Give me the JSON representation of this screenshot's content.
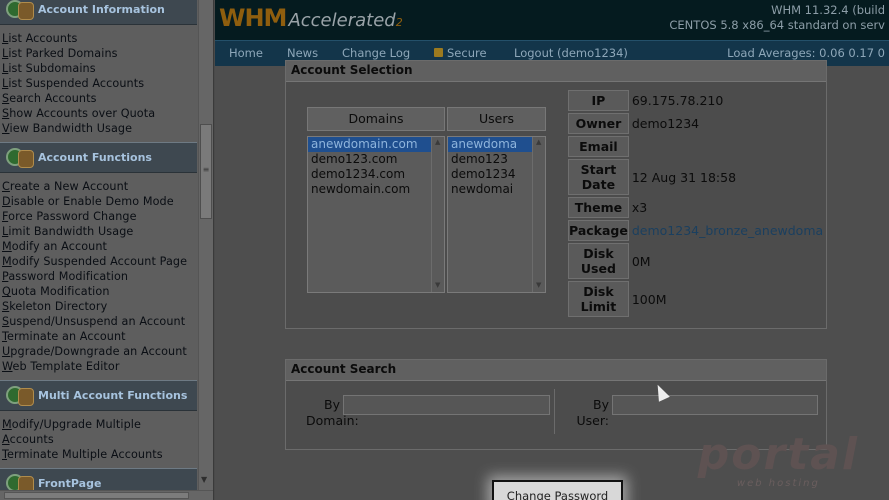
{
  "sidebar": {
    "sections": [
      {
        "title": "Account Information",
        "links": [
          "List Accounts",
          "List Parked Domains",
          "List Subdomains",
          "List Suspended Accounts",
          "Search Accounts",
          "Show Accounts over Quota",
          "View Bandwidth Usage"
        ]
      },
      {
        "title": "Account Functions",
        "links": [
          "Create a New Account",
          "Disable or Enable Demo Mode",
          "Force Password Change",
          "Limit Bandwidth Usage",
          "Modify an Account",
          "Modify Suspended Account Page",
          "Password Modification",
          "Quota Modification",
          "Skeleton Directory",
          "Suspend/Unsuspend an Account",
          "Terminate an Account",
          "Upgrade/Downgrade an Account",
          "Web Template Editor"
        ]
      },
      {
        "title": "Multi Account Functions",
        "links": [
          "Modify/Upgrade Multiple",
          "Accounts",
          "Terminate Multiple Accounts"
        ]
      },
      {
        "title": "FrontPage",
        "links": []
      }
    ],
    "icons": [
      "info-icon",
      "account-functions-icon",
      "multi-account-icon",
      "frontpage-icon"
    ]
  },
  "header": {
    "logo_main": "WHM",
    "logo_accel": "Accelerated",
    "logo_sub": "2",
    "version_line": "WHM 11.32.4 (build",
    "os_line": "CENTOS 5.8 x86_64 standard on serv"
  },
  "nav": {
    "items": [
      "Home",
      "News",
      "Change Log",
      "Secure",
      "Logout (demo1234)"
    ],
    "loads": "Load Averages: 0.06 0.17 0"
  },
  "account_selection": {
    "title": "Account Selection",
    "domains_header": "Domains",
    "users_header": "Users",
    "domains": [
      "anewdomain.com",
      "demo123.com",
      "demo1234.com",
      "newdomain.com"
    ],
    "users": [
      "anewdoma",
      "demo123",
      "demo1234",
      "newdomai"
    ],
    "selected_index": 0,
    "info": [
      {
        "key": "IP",
        "value": "69.175.78.210"
      },
      {
        "key": "Owner",
        "value": "demo1234"
      },
      {
        "key": "Email",
        "value": ""
      },
      {
        "key": "Start Date",
        "value": "12 Aug 31 18:58"
      },
      {
        "key": "Theme",
        "value": "x3"
      },
      {
        "key": "Package",
        "value": "demo1234_bronze_anewdoma"
      },
      {
        "key": "Disk Used",
        "value": "0M"
      },
      {
        "key": "Disk Limit",
        "value": "100M"
      }
    ]
  },
  "account_search": {
    "title": "Account Search",
    "by_domain_label_1": "By",
    "by_domain_label_2": "Domain:",
    "by_user_label_1": "By",
    "by_user_label_2": "User:",
    "domain_value": "",
    "user_value": ""
  },
  "change_password_button": "Change Password",
  "watermark": {
    "big": "portal",
    "small": "web hosting"
  },
  "colors": {
    "accent_orange": "#8f5e0e",
    "nav_bg": "#13354a",
    "selection": "#1f4f8f"
  }
}
